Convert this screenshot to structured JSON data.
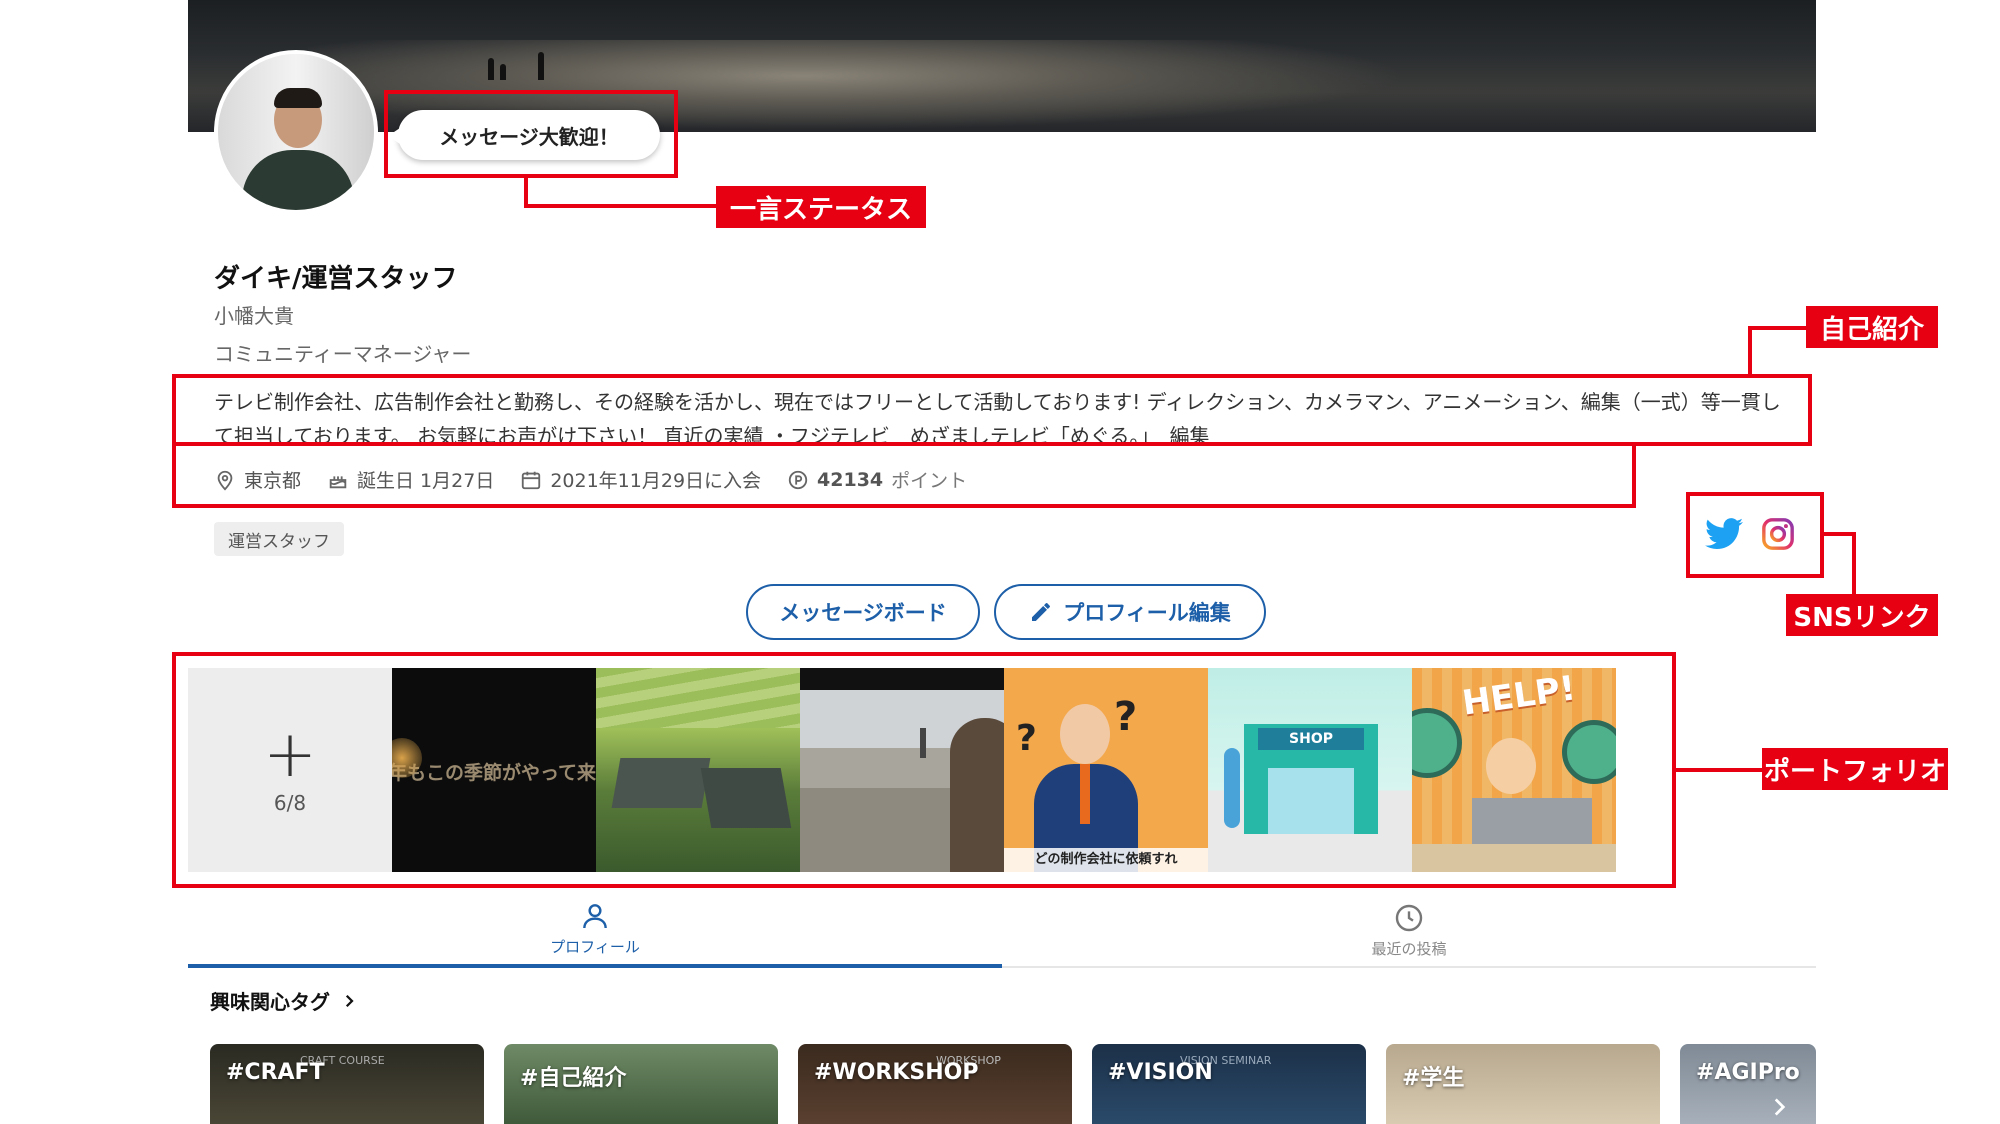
{
  "status": {
    "text": "メッセージ大歓迎！"
  },
  "profile": {
    "display_name": "ダイキ/運営スタッフ",
    "real_name": "小幡大貴",
    "role": "コミュニティーマネージャー",
    "bio": "テレビ制作会社、広告制作会社と勤務し、その経験を活かし、現在ではフリーとして活動しております! ディレクション、カメラマン、アニメーション、編集（一式）等一貫して担当しております。 お気軽にお声がけ下さい！ 直近の実績 ・フジテレビ　めざましテレビ「めぐる。」　編集",
    "location": "東京都",
    "birthday": "誕生日 1月27日",
    "joined": "2021年11月29日に入会",
    "points": "42134",
    "points_unit": "ポイント",
    "tag": "運営スタッフ"
  },
  "actions": {
    "message_board": "メッセージボード",
    "edit_profile": "プロフィール編集"
  },
  "portfolio": {
    "count": "6/8",
    "thumb_text_1": "年もこの季節がやって来",
    "thumb_text_5": "どの制作会社に依頼すれ",
    "thumb_text_6": "SHOP",
    "thumb_text_7": "HELP!"
  },
  "tabs": [
    {
      "label": "プロフィール"
    },
    {
      "label": "最近の投稿"
    }
  ],
  "interests": {
    "title": "興味関心タグ",
    "tags": [
      {
        "label": "#CRAFT",
        "sub": "CRAFT COURSE"
      },
      {
        "label": "#自己紹介",
        "sub": ""
      },
      {
        "label": "#WORKSHOP",
        "sub": "WORKSHOP"
      },
      {
        "label": "#VISION",
        "sub": "VISION SEMINAR"
      },
      {
        "label": "#学生",
        "sub": ""
      },
      {
        "label": "#AGIPro",
        "sub": ""
      }
    ]
  },
  "annotations": {
    "status": "一言ステータス",
    "bio": "自己紹介",
    "sns": "SNSリンク",
    "portfolio": "ポートフォリオ"
  },
  "colors": {
    "accent": "#1d5fa8",
    "annotation": "#e60012",
    "twitter": "#1da1f2"
  },
  "icons": [
    "location-icon",
    "cake-icon",
    "calendar-icon",
    "points-icon",
    "twitter-icon",
    "instagram-icon",
    "pencil-icon",
    "plus-icon",
    "person-icon",
    "clock-icon",
    "chevron-right-icon"
  ]
}
